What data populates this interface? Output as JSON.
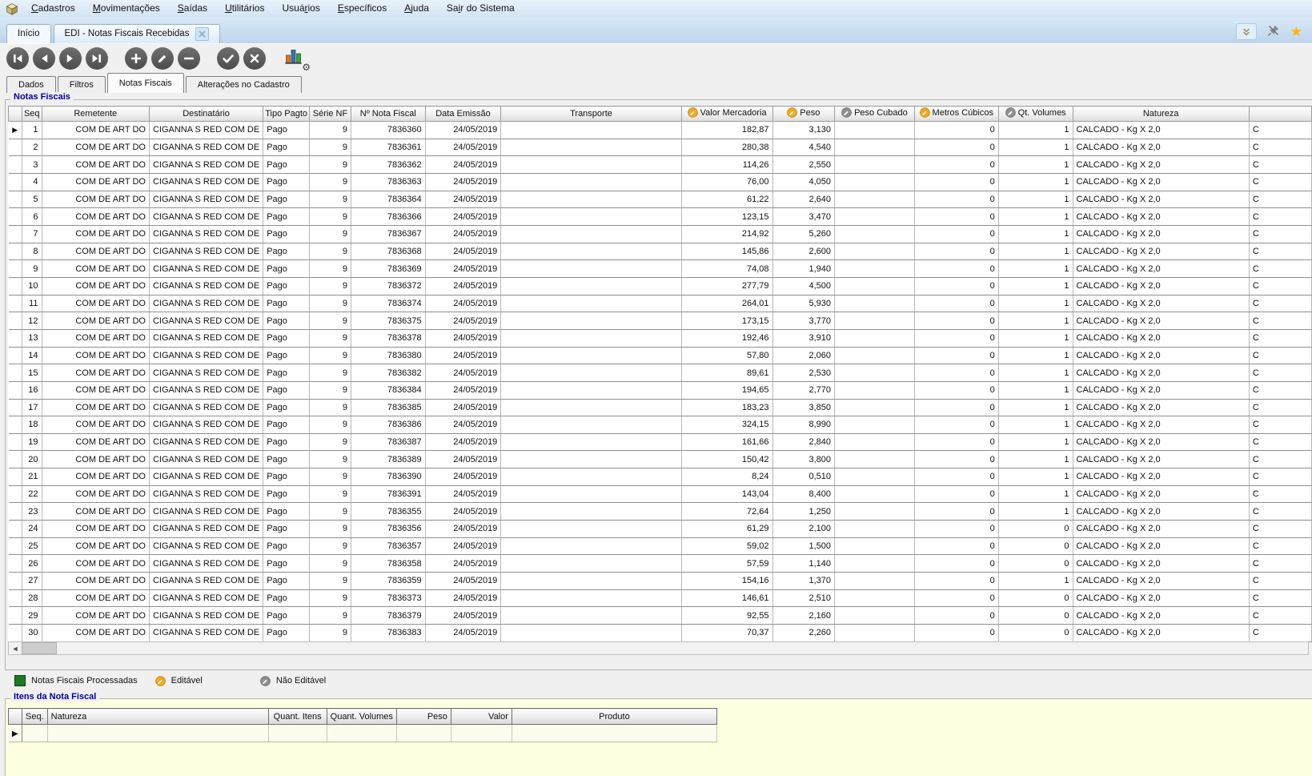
{
  "menu": {
    "items": [
      {
        "pre": "",
        "key": "C",
        "post": "adastros",
        "id": "cadastros"
      },
      {
        "pre": "",
        "key": "M",
        "post": "ovimentações",
        "id": "movimentacoes"
      },
      {
        "pre": "",
        "key": "S",
        "post": "aídas",
        "id": "saidas"
      },
      {
        "pre": "",
        "key": "U",
        "post": "tilitários",
        "id": "utilitarios"
      },
      {
        "pre": "Usuá",
        "key": "r",
        "post": "ios",
        "id": "usuarios"
      },
      {
        "pre": "",
        "key": "E",
        "post": "specíficos",
        "id": "especificos"
      },
      {
        "pre": "",
        "key": "A",
        "post": "juda",
        "id": "ajuda"
      },
      {
        "pre": "Sa",
        "key": "i",
        "post": "r do Sistema",
        "id": "sair-do-sistema"
      }
    ]
  },
  "tabs": {
    "home_label": "Início",
    "active_label": "EDI - Notas Fiscais Recebidas"
  },
  "header_icons": [
    "collapse-chevron-icon",
    "unpin-icon",
    "favorite-star-icon"
  ],
  "toolbar": {
    "groups": [
      [
        "nav-first",
        "nav-prev",
        "nav-next",
        "nav-last"
      ],
      [
        "add-record",
        "edit-record",
        "delete-record"
      ],
      [
        "confirm",
        "cancel"
      ]
    ],
    "chart_button": "chart-settings"
  },
  "subtabs": {
    "items": [
      "Dados",
      "Filtros",
      "Notas Fiscais",
      "Alterações no Cadastro"
    ],
    "active_index": 2
  },
  "notas_fiscais": {
    "title": "Notas Fiscais",
    "columns": [
      {
        "label": "",
        "icon": null
      },
      {
        "label": "Seq",
        "icon": null
      },
      {
        "label": "Remetente",
        "icon": null
      },
      {
        "label": "Destinatário",
        "icon": null
      },
      {
        "label": "Tipo Pagto",
        "icon": null
      },
      {
        "label": "Série NF",
        "icon": null
      },
      {
        "label": "Nº Nota Fiscal",
        "icon": null
      },
      {
        "label": "Data Emissão",
        "icon": null
      },
      {
        "label": "Transporte",
        "icon": null
      },
      {
        "label": "Valor Mercadoria",
        "icon": "editable"
      },
      {
        "label": "Peso",
        "icon": "editable"
      },
      {
        "label": "Peso Cubado",
        "icon": "locked"
      },
      {
        "label": "Metros Cúbicos",
        "icon": "editable"
      },
      {
        "label": "Qt. Volumes",
        "icon": "locked"
      },
      {
        "label": "Natureza",
        "icon": null
      },
      {
        "label": "",
        "icon": null
      }
    ],
    "selected_row_seq": "1",
    "rows": [
      [
        "1",
        "COM DE ART DO",
        "CIGANNA S RED COM DE",
        "Pago",
        "9",
        "7836360",
        "24/05/2019",
        "",
        "182,87",
        "3,130",
        "",
        "0",
        "1",
        "CALCADO - Kg X 2,0",
        "C"
      ],
      [
        "2",
        "COM DE ART DO",
        "CIGANNA S RED COM DE",
        "Pago",
        "9",
        "7836361",
        "24/05/2019",
        "",
        "280,38",
        "4,540",
        "",
        "0",
        "1",
        "CALCADO - Kg X 2,0",
        "C"
      ],
      [
        "3",
        "COM DE ART DO",
        "CIGANNA S RED COM DE",
        "Pago",
        "9",
        "7836362",
        "24/05/2019",
        "",
        "114,26",
        "2,550",
        "",
        "0",
        "1",
        "CALCADO - Kg X 2,0",
        "C"
      ],
      [
        "4",
        "COM DE ART DO",
        "CIGANNA S RED COM DE",
        "Pago",
        "9",
        "7836363",
        "24/05/2019",
        "",
        "76,00",
        "4,050",
        "",
        "0",
        "1",
        "CALCADO - Kg X 2,0",
        "C"
      ],
      [
        "5",
        "COM DE ART DO",
        "CIGANNA S RED COM DE",
        "Pago",
        "9",
        "7836364",
        "24/05/2019",
        "",
        "61,22",
        "2,640",
        "",
        "0",
        "1",
        "CALCADO - Kg X 2,0",
        "C"
      ],
      [
        "6",
        "COM DE ART DO",
        "CIGANNA S RED COM DE",
        "Pago",
        "9",
        "7836366",
        "24/05/2019",
        "",
        "123,15",
        "3,470",
        "",
        "0",
        "1",
        "CALCADO - Kg X 2,0",
        "C"
      ],
      [
        "7",
        "COM DE ART DO",
        "CIGANNA S RED COM DE",
        "Pago",
        "9",
        "7836367",
        "24/05/2019",
        "",
        "214,92",
        "5,260",
        "",
        "0",
        "1",
        "CALCADO - Kg X 2,0",
        "C"
      ],
      [
        "8",
        "COM DE ART DO",
        "CIGANNA S RED COM DE",
        "Pago",
        "9",
        "7836368",
        "24/05/2019",
        "",
        "145,86",
        "2,600",
        "",
        "0",
        "1",
        "CALCADO - Kg X 2,0",
        "C"
      ],
      [
        "9",
        "COM DE ART DO",
        "CIGANNA S RED COM DE",
        "Pago",
        "9",
        "7836369",
        "24/05/2019",
        "",
        "74,08",
        "1,940",
        "",
        "0",
        "1",
        "CALCADO - Kg X 2,0",
        "C"
      ],
      [
        "10",
        "COM DE ART DO",
        "CIGANNA S RED COM DE",
        "Pago",
        "9",
        "7836372",
        "24/05/2019",
        "",
        "277,79",
        "4,500",
        "",
        "0",
        "1",
        "CALCADO - Kg X 2,0",
        "C"
      ],
      [
        "11",
        "COM DE ART DO",
        "CIGANNA S RED COM DE",
        "Pago",
        "9",
        "7836374",
        "24/05/2019",
        "",
        "264,01",
        "5,930",
        "",
        "0",
        "1",
        "CALCADO - Kg X 2,0",
        "C"
      ],
      [
        "12",
        "COM DE ART DO",
        "CIGANNA S RED COM DE",
        "Pago",
        "9",
        "7836375",
        "24/05/2019",
        "",
        "173,15",
        "3,770",
        "",
        "0",
        "1",
        "CALCADO - Kg X 2,0",
        "C"
      ],
      [
        "13",
        "COM DE ART DO",
        "CIGANNA S RED COM DE",
        "Pago",
        "9",
        "7836378",
        "24/05/2019",
        "",
        "192,46",
        "3,910",
        "",
        "0",
        "1",
        "CALCADO - Kg X 2,0",
        "C"
      ],
      [
        "14",
        "COM DE ART DO",
        "CIGANNA S RED COM DE",
        "Pago",
        "9",
        "7836380",
        "24/05/2019",
        "",
        "57,80",
        "2,060",
        "",
        "0",
        "1",
        "CALCADO - Kg X 2,0",
        "C"
      ],
      [
        "15",
        "COM DE ART DO",
        "CIGANNA S RED COM DE",
        "Pago",
        "9",
        "7836382",
        "24/05/2019",
        "",
        "89,61",
        "2,530",
        "",
        "0",
        "1",
        "CALCADO - Kg X 2,0",
        "C"
      ],
      [
        "16",
        "COM DE ART DO",
        "CIGANNA S RED COM DE",
        "Pago",
        "9",
        "7836384",
        "24/05/2019",
        "",
        "194,65",
        "2,770",
        "",
        "0",
        "1",
        "CALCADO - Kg X 2,0",
        "C"
      ],
      [
        "17",
        "COM DE ART DO",
        "CIGANNA S RED COM DE",
        "Pago",
        "9",
        "7836385",
        "24/05/2019",
        "",
        "183,23",
        "3,850",
        "",
        "0",
        "1",
        "CALCADO - Kg X 2,0",
        "C"
      ],
      [
        "18",
        "COM DE ART DO",
        "CIGANNA S RED COM DE",
        "Pago",
        "9",
        "7836386",
        "24/05/2019",
        "",
        "324,15",
        "8,990",
        "",
        "0",
        "1",
        "CALCADO - Kg X 2,0",
        "C"
      ],
      [
        "19",
        "COM DE ART DO",
        "CIGANNA S RED COM DE",
        "Pago",
        "9",
        "7836387",
        "24/05/2019",
        "",
        "161,66",
        "2,840",
        "",
        "0",
        "1",
        "CALCADO - Kg X 2,0",
        "C"
      ],
      [
        "20",
        "COM DE ART DO",
        "CIGANNA S RED COM DE",
        "Pago",
        "9",
        "7836389",
        "24/05/2019",
        "",
        "150,42",
        "3,800",
        "",
        "0",
        "1",
        "CALCADO - Kg X 2,0",
        "C"
      ],
      [
        "21",
        "COM DE ART DO",
        "CIGANNA S RED COM DE",
        "Pago",
        "9",
        "7836390",
        "24/05/2019",
        "",
        "8,24",
        "0,510",
        "",
        "0",
        "1",
        "CALCADO - Kg X 2,0",
        "C"
      ],
      [
        "22",
        "COM DE ART DO",
        "CIGANNA S RED COM DE",
        "Pago",
        "9",
        "7836391",
        "24/05/2019",
        "",
        "143,04",
        "8,400",
        "",
        "0",
        "1",
        "CALCADO - Kg X 2,0",
        "C"
      ],
      [
        "23",
        "COM DE ART DO",
        "CIGANNA S RED COM DE",
        "Pago",
        "9",
        "7836355",
        "24/05/2019",
        "",
        "72,64",
        "1,250",
        "",
        "0",
        "1",
        "CALCADO - Kg X 2,0",
        "C"
      ],
      [
        "24",
        "COM DE ART DO",
        "CIGANNA S RED COM DE",
        "Pago",
        "9",
        "7836356",
        "24/05/2019",
        "",
        "61,29",
        "2,100",
        "",
        "0",
        "0",
        "CALCADO - Kg X 2,0",
        "C"
      ],
      [
        "25",
        "COM DE ART DO",
        "CIGANNA S RED COM DE",
        "Pago",
        "9",
        "7836357",
        "24/05/2019",
        "",
        "59,02",
        "1,500",
        "",
        "0",
        "0",
        "CALCADO - Kg X 2,0",
        "C"
      ],
      [
        "26",
        "COM DE ART DO",
        "CIGANNA S RED COM DE",
        "Pago",
        "9",
        "7836358",
        "24/05/2019",
        "",
        "57,59",
        "1,140",
        "",
        "0",
        "0",
        "CALCADO - Kg X 2,0",
        "C"
      ],
      [
        "27",
        "COM DE ART DO",
        "CIGANNA S RED COM DE",
        "Pago",
        "9",
        "7836359",
        "24/05/2019",
        "",
        "154,16",
        "1,370",
        "",
        "0",
        "1",
        "CALCADO - Kg X 2,0",
        "C"
      ],
      [
        "28",
        "COM DE ART DO",
        "CIGANNA S RED COM DE",
        "Pago",
        "9",
        "7836373",
        "24/05/2019",
        "",
        "146,61",
        "2,510",
        "",
        "0",
        "0",
        "CALCADO - Kg X 2,0",
        "C"
      ],
      [
        "29",
        "COM DE ART DO",
        "CIGANNA S RED COM DE",
        "Pago",
        "9",
        "7836379",
        "24/05/2019",
        "",
        "92,55",
        "2,160",
        "",
        "0",
        "0",
        "CALCADO - Kg X 2,0",
        "C"
      ],
      [
        "30",
        "COM DE ART DO",
        "CIGANNA S RED COM DE",
        "Pago",
        "9",
        "7836383",
        "24/05/2019",
        "",
        "70,37",
        "2,260",
        "",
        "0",
        "0",
        "CALCADO - Kg X 2,0",
        "C"
      ]
    ]
  },
  "legend": {
    "items": [
      {
        "type": "processed",
        "label": "Notas Fiscais Processadas",
        "color": "#1c7a24"
      },
      {
        "type": "editable",
        "label": "Editável",
        "color": "#f6a71b"
      },
      {
        "type": "locked",
        "label": "Não Editável",
        "color": "#909090"
      }
    ]
  },
  "itens_nota": {
    "title": "Itens da Nota Fiscal",
    "columns": [
      "Seq.",
      "Natureza",
      "Quant. Itens",
      "Quant. Volumes",
      "Peso",
      "Valor",
      "Produto"
    ]
  }
}
